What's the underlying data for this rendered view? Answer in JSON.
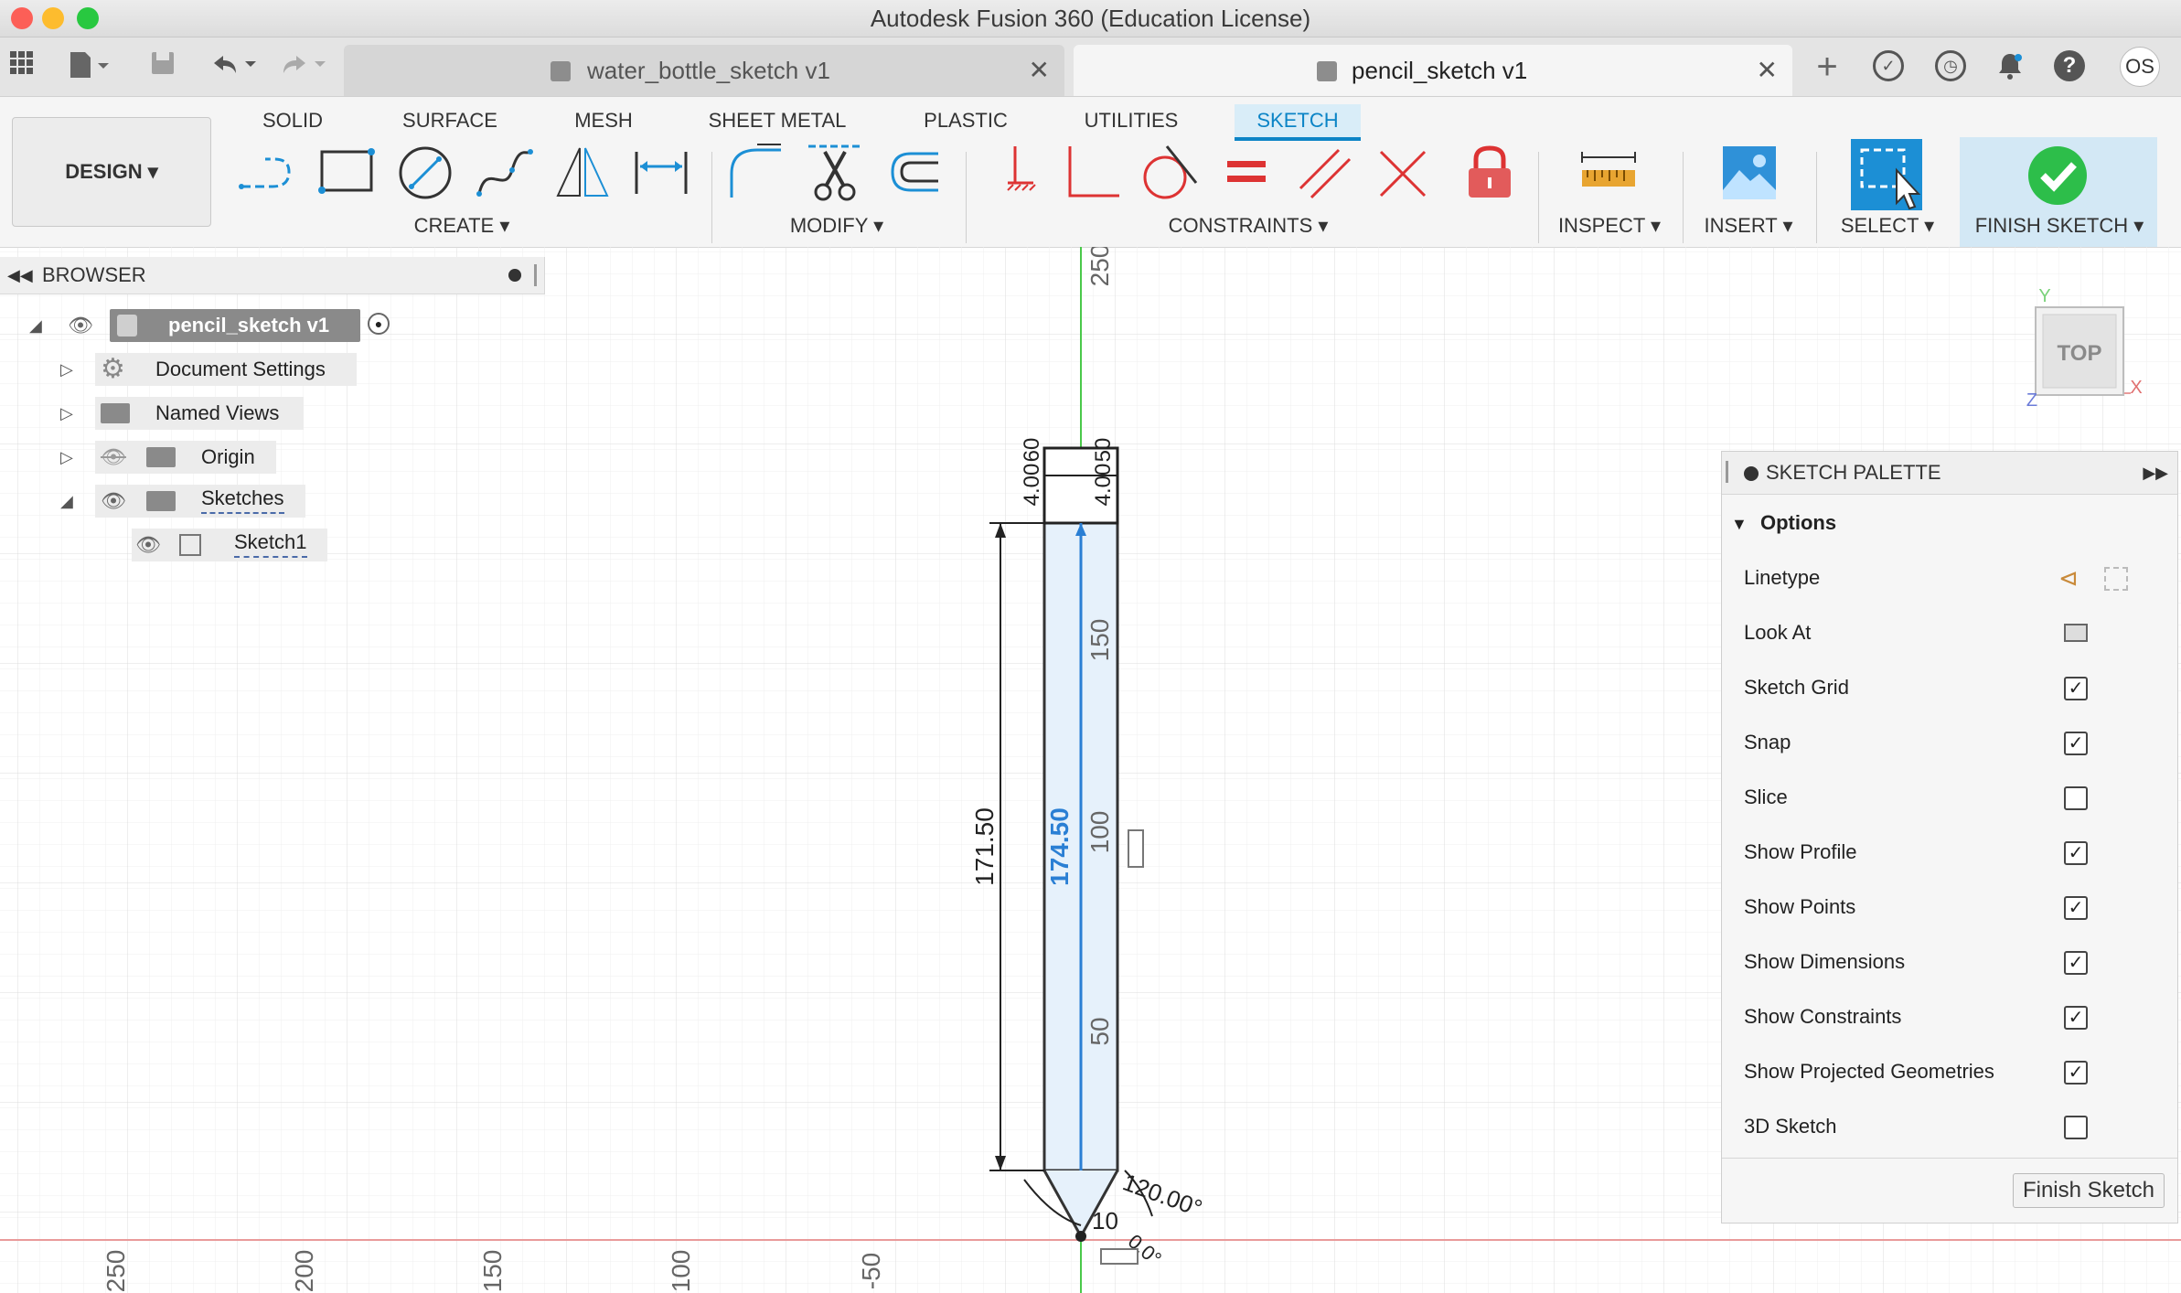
{
  "window": {
    "title": "Autodesk Fusion 360 (Education License)"
  },
  "tabs": [
    {
      "label": "water_bottle_sketch v1",
      "active": false
    },
    {
      "label": "pencil_sketch v1",
      "active": true
    }
  ],
  "user": {
    "initials": "OS"
  },
  "ribbon": {
    "workspace": "DESIGN",
    "tabs": [
      "SOLID",
      "SURFACE",
      "MESH",
      "SHEET METAL",
      "PLASTIC",
      "UTILITIES",
      "SKETCH"
    ],
    "active_tab": "SKETCH",
    "groups": {
      "create": "CREATE",
      "modify": "MODIFY",
      "constraints": "CONSTRAINTS",
      "inspect": "INSPECT",
      "insert": "INSERT",
      "select": "SELECT",
      "finish": "FINISH SKETCH"
    }
  },
  "browser": {
    "title": "BROWSER",
    "root": "pencil_sketch v1",
    "items": [
      {
        "label": "Document Settings",
        "icon": "gear-icon"
      },
      {
        "label": "Named Views",
        "icon": "folder-icon"
      },
      {
        "label": "Origin",
        "icon": "folder-icon"
      },
      {
        "label": "Sketches",
        "icon": "folder-icon"
      }
    ],
    "sketch": "Sketch1"
  },
  "canvas": {
    "view_cube": "TOP",
    "axis_y": "Y",
    "axis_x": "X",
    "axis_z": "Z",
    "ruler_vertical": [
      "250",
      "150",
      "100",
      "50"
    ],
    "ruler_horizontal": [
      "250",
      "200",
      "150",
      "100",
      "-50"
    ],
    "dimensions": {
      "overall": "171.50",
      "inner": "174.50",
      "top_a": "4.00",
      "top_b": "60",
      "top_c": "4.00",
      "top_d": "50",
      "angle": "120.00°",
      "tip_gap": "10",
      "tip_angle": "0.0°"
    }
  },
  "palette": {
    "title": "SKETCH PALETTE",
    "section": "Options",
    "linetype_label": "Linetype",
    "look_at_label": "Look At",
    "options": [
      {
        "label": "Sketch Grid",
        "checked": true
      },
      {
        "label": "Snap",
        "checked": true
      },
      {
        "label": "Slice",
        "checked": false
      },
      {
        "label": "Show Profile",
        "checked": true
      },
      {
        "label": "Show Points",
        "checked": true
      },
      {
        "label": "Show Dimensions",
        "checked": true
      },
      {
        "label": "Show Constraints",
        "checked": true
      },
      {
        "label": "Show Projected Geometries",
        "checked": true
      },
      {
        "label": "3D Sketch",
        "checked": false
      }
    ],
    "finish_button": "Finish Sketch"
  },
  "colors": {
    "accent": "#0b84c6",
    "grid": "#e6e6e6",
    "profile_fill": "#e6f1fb",
    "y_axis": "#4ac94a",
    "x_axis": "#e99a9a"
  }
}
